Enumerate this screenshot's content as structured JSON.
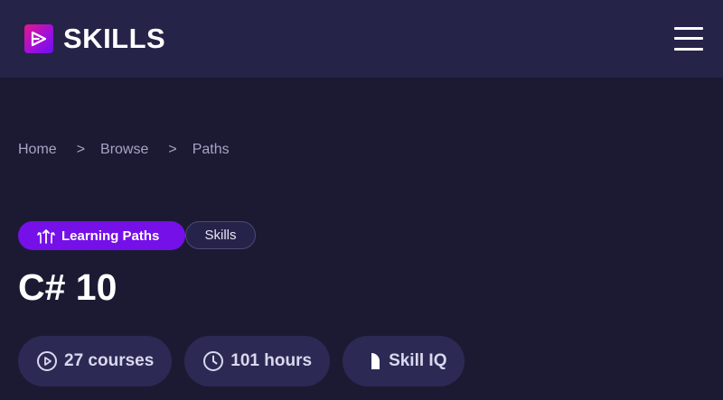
{
  "header": {
    "brand": "SKILLS",
    "logo_icon": "play-triangle-icon",
    "menu_icon": "hamburger-menu-icon"
  },
  "breadcrumb": {
    "items": [
      "Home",
      "Browse",
      "Paths"
    ],
    "separator": ">"
  },
  "tags": {
    "primary": {
      "label": "Learning Paths",
      "icon": "paths-arrows-icon"
    },
    "secondary": {
      "label": "Skills"
    }
  },
  "title": "C# 10",
  "stats": [
    {
      "label": "27 courses",
      "icon": "play-circle-icon"
    },
    {
      "label": "101 hours",
      "icon": "clock-icon"
    },
    {
      "label": "Skill IQ",
      "icon": "skill-iq-icon"
    }
  ],
  "colors": {
    "background": "#1c1a33",
    "header": "#252347",
    "accent": "#7610e8",
    "pill": "#2c2a54"
  }
}
